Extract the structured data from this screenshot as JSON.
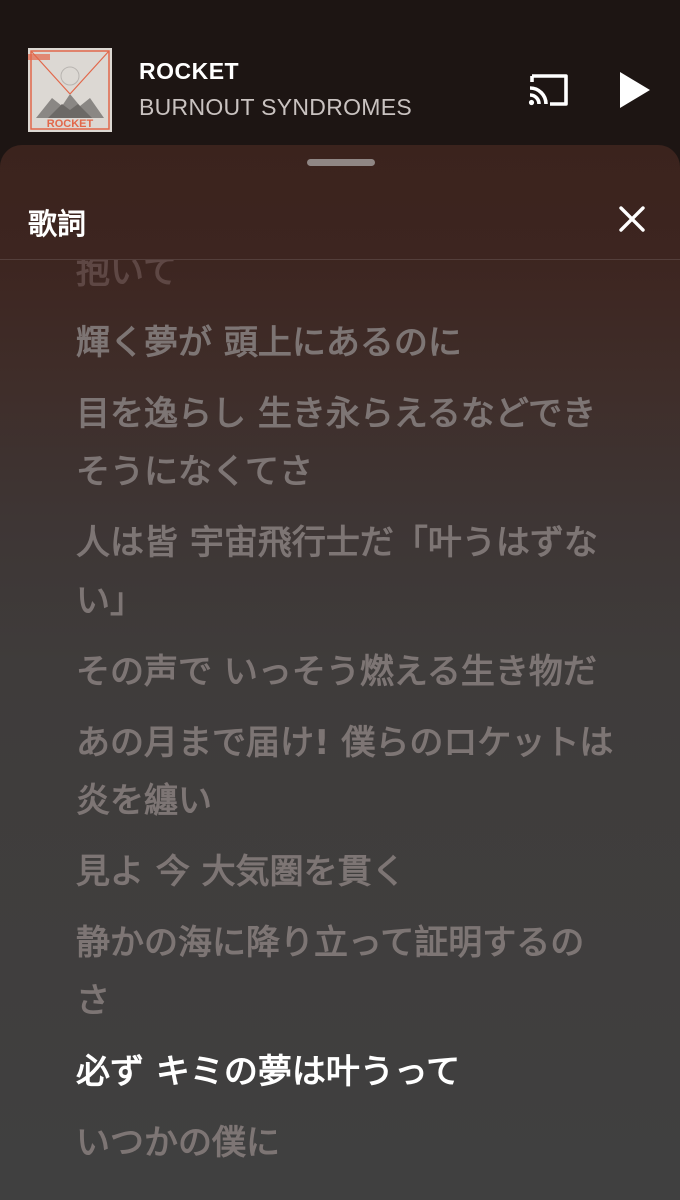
{
  "mini_player": {
    "title": "ROCKET",
    "artist": "BURNOUT SYNDROMES",
    "album_art_text": "ROCKET",
    "cast_icon": "cast-icon",
    "play_icon": "play-icon"
  },
  "lyrics_sheet": {
    "title": "歌詞",
    "close_icon": "close-icon"
  },
  "lyrics": [
    {
      "text": "抱いて",
      "state": "faded"
    },
    {
      "text": "輝く夢が 頭上にあるのに",
      "state": "normal"
    },
    {
      "text": "目を逸らし 生き永らえるなどできそうになくてさ",
      "state": "normal"
    },
    {
      "text": "人は皆 宇宙飛行士だ「叶うはずない」",
      "state": "normal"
    },
    {
      "text": "その声で いっそう燃える生き物だ",
      "state": "normal"
    },
    {
      "text": "あの月まで届け! 僕らのロケットは炎を纏い",
      "state": "normal"
    },
    {
      "text": "見よ 今 大気圏を貫く",
      "state": "normal"
    },
    {
      "text": "静かの海に降り立って証明するのさ",
      "state": "normal"
    },
    {
      "text": "必ず キミの夢は叶うって",
      "state": "active"
    },
    {
      "text": "いつかの僕に",
      "state": "normal"
    }
  ],
  "colors": {
    "background": "#1d1513",
    "active_lyric": "#ffffff",
    "inactive_lyric": "#7d7574"
  }
}
